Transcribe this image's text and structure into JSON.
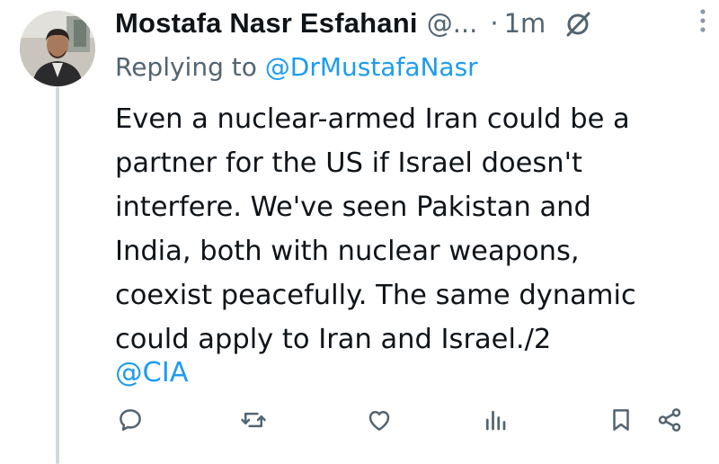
{
  "tweet": {
    "display_name": "Mostafa Nasr Esfahani",
    "handle": "@...",
    "separator": "·",
    "time": "1m",
    "reply_prefix": "Replying to",
    "reply_to": "@DrMustafaNasr",
    "body_lines": [
      "Even a nuclear-armed Iran could be a",
      "partner for the US if Israel doesn't",
      "interfere. We've seen Pakistan and",
      "India, both with nuclear weapons,",
      "coexist peacefully. The same dynamic",
      "could apply to Iran and Israel./2"
    ],
    "tag": "@CIA"
  },
  "icons": {
    "grok": "grok-slash-icon",
    "more": "more-vertical-icon",
    "reply": "reply-bubble-icon",
    "retweet": "retweet-icon",
    "like": "heart-icon",
    "views": "views-bars-icon",
    "bookmark": "bookmark-icon",
    "share": "share-icon"
  },
  "colors": {
    "text": "#0f1419",
    "secondary": "#536471",
    "link": "#1d9bf0",
    "thread_line": "#cfd9de"
  }
}
